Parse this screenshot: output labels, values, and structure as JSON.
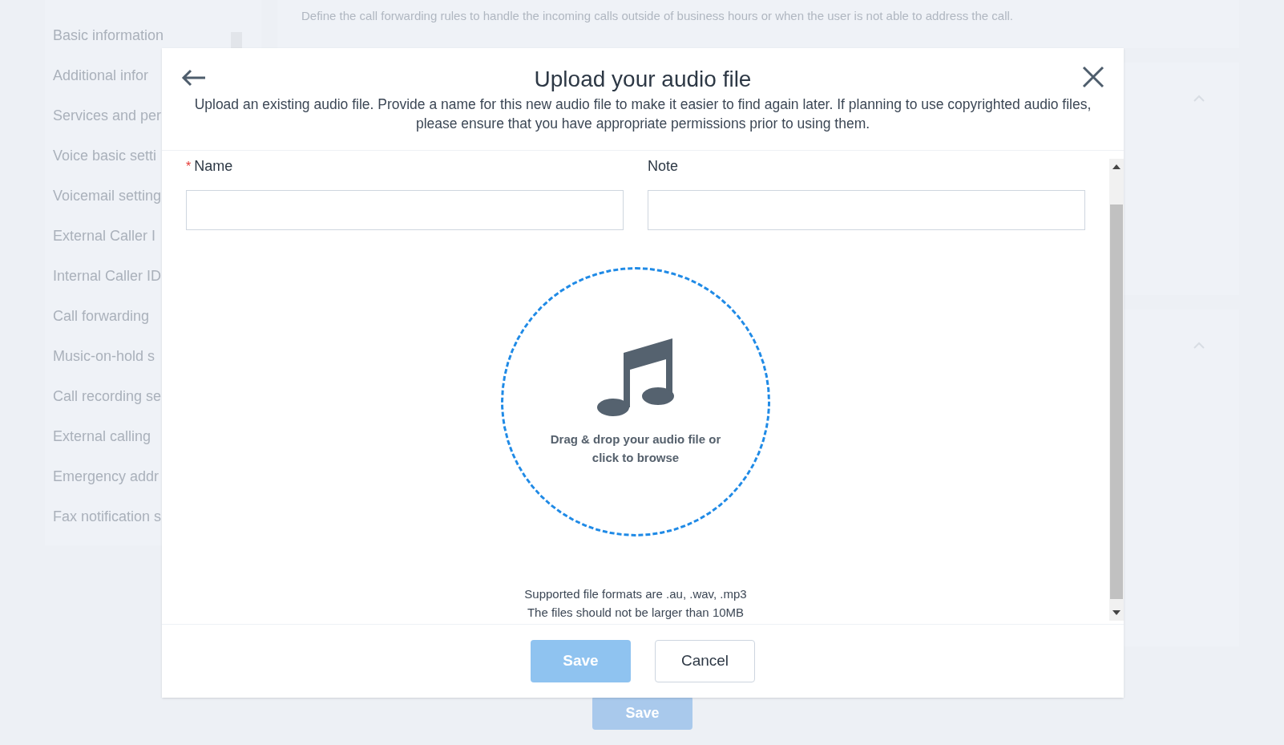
{
  "background": {
    "sidebar_items": [
      "Basic information",
      "Additional infor",
      "Services and per",
      "Voice basic setti",
      "Voicemail setting",
      "External Caller I",
      "Internal Caller ID",
      "Call forwarding",
      "Music-on-hold s",
      "Call recording se",
      "External calling",
      "Emergency addr",
      "Fax notification s"
    ],
    "description": "Define the call forwarding rules to handle the incoming calls outside of business hours or when the user is not able to address the call.",
    "save_button": "Save"
  },
  "dialog": {
    "title": "Upload your audio file",
    "description": "Upload an existing audio file. Provide a name for this new audio file to make it easier to find again later. If planning to use copyrighted audio files, please ensure that you have appropriate permissions prior to using them.",
    "fields": [
      {
        "label": "Name",
        "required_mark": "*"
      },
      {
        "label": "Note"
      }
    ],
    "drop_zone": "Drag & drop your audio file or click to browse",
    "formats_note": "Supported file formats are .au, .wav, .mp3",
    "size_note": "The files should not be larger than 10MB",
    "buttons": [
      {
        "label": "Save",
        "kind": "primary",
        "disabled": true
      },
      {
        "label": "Cancel",
        "kind": "secondary",
        "disabled": false
      }
    ]
  }
}
